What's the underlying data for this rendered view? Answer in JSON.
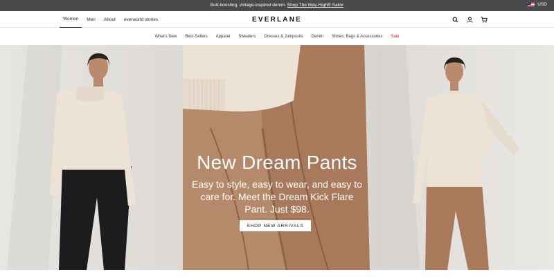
{
  "promo": {
    "text": "Butt-boosting, vintage-inspired denim.",
    "link": "Shop The Way-High® Sailor",
    "currency": "USD"
  },
  "header": {
    "nav": [
      {
        "label": "Women",
        "active": true
      },
      {
        "label": "Men",
        "active": false
      },
      {
        "label": "About",
        "active": false
      },
      {
        "label": "everworld stories",
        "active": false
      }
    ],
    "logo": "EVERLANE",
    "icons": [
      "search-icon",
      "account-icon",
      "cart-icon"
    ]
  },
  "categories": [
    {
      "label": "What's New"
    },
    {
      "label": "Best-Sellers"
    },
    {
      "label": "Apparel"
    },
    {
      "label": "Sweaters"
    },
    {
      "label": "Dresses & Jumpsuits"
    },
    {
      "label": "Denim"
    },
    {
      "label": "Shoes, Bags & Accessories"
    },
    {
      "label": "Sale",
      "highlight": true
    }
  ],
  "hero": {
    "title": "New Dream Pants",
    "subtitle": "Easy to style, easy to wear, and easy to care for. Meet the Dream Kick Flare Pant. Just $98.",
    "button": "SHOP NEW ARRIVALS"
  },
  "colors": {
    "promo_bg": "#4a4a4a",
    "sale": "#d9171d",
    "camel": "#a9795b",
    "cream": "#ece3d6"
  }
}
